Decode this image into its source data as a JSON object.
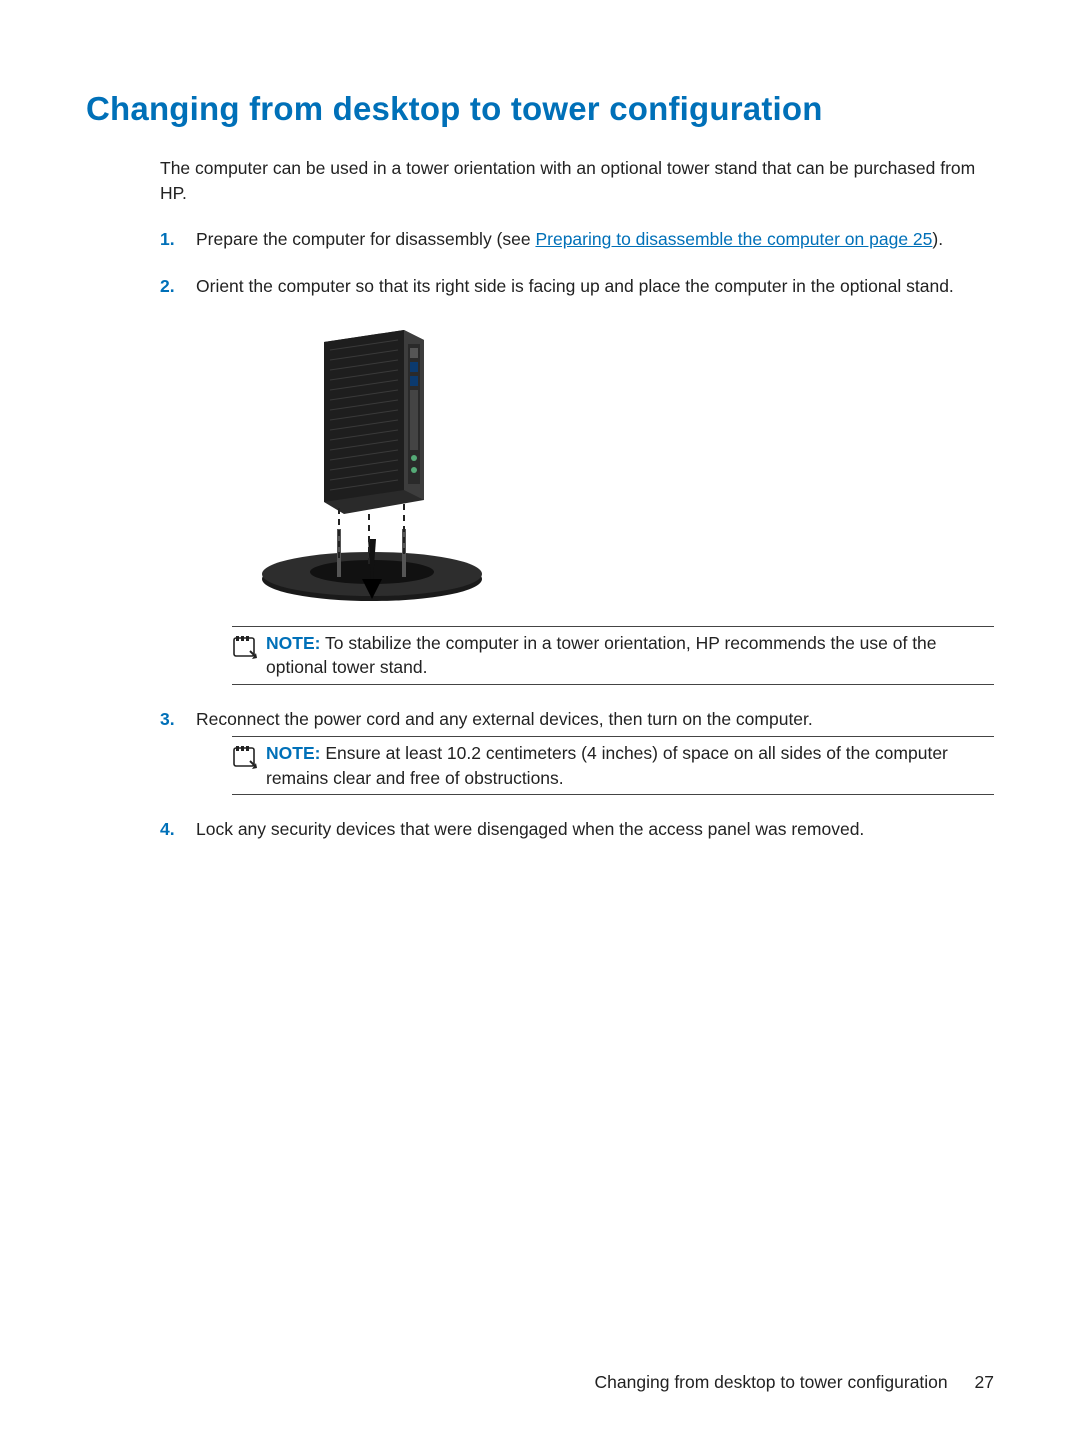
{
  "heading": "Changing from desktop to tower configuration",
  "intro": "The computer can be used in a tower orientation with an optional tower stand that can be purchased from HP.",
  "steps": {
    "1": {
      "num": "1.",
      "text_before": "Prepare the computer for disassembly (see ",
      "xref": "Preparing to disassemble the computer on page 25",
      "text_after": ")."
    },
    "2": {
      "num": "2.",
      "text": "Orient the computer so that its right side is facing up and place the computer in the optional stand."
    },
    "3": {
      "num": "3.",
      "text": "Reconnect the power cord and any external devices, then turn on the computer."
    },
    "4": {
      "num": "4.",
      "text": "Lock any security devices that were disengaged when the access panel was removed."
    }
  },
  "notes": {
    "label": "NOTE:",
    "stabilize": "To stabilize the computer in a tower orientation, HP recommends the use of the optional tower stand.",
    "clearance": "Ensure at least 10.2 centimeters (4 inches) of space on all sides of the computer remains clear and free of obstructions."
  },
  "footer": {
    "title": "Changing from desktop to tower configuration",
    "page": "27"
  }
}
